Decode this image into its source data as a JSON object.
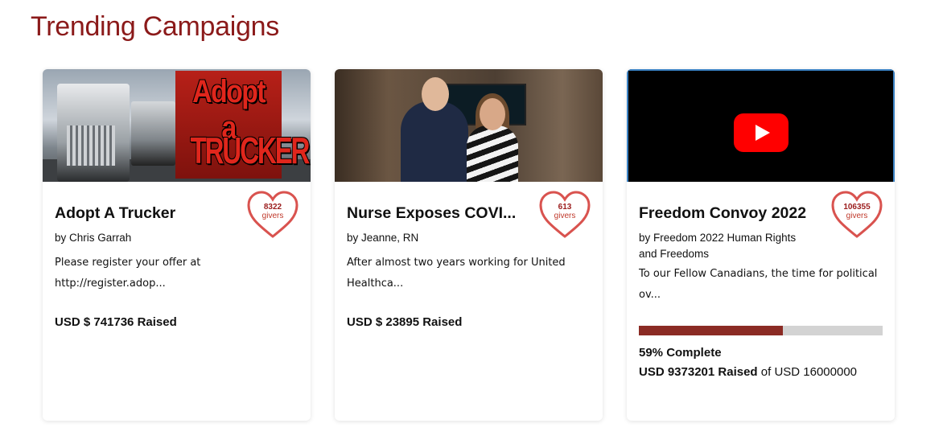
{
  "section": {
    "title": "Trending Campaigns"
  },
  "campaigns": [
    {
      "title": "Adopt A Trucker",
      "author": "by Chris Garrah",
      "description": "Please register your offer at http://register.adop...",
      "heart_count": "8322",
      "heart_label": "givers",
      "raised": "USD $ 741736 Raised",
      "thumbnail_text": [
        "Adopt a",
        "TRUCKER"
      ]
    },
    {
      "title": "Nurse Exposes COVI...",
      "author": "by Jeanne, RN",
      "description": "After almost two years working for United Healthca...",
      "heart_count": "613",
      "heart_label": "givers",
      "raised": "USD $ 23895 Raised"
    },
    {
      "title": "Freedom Convoy 2022",
      "author": "by Freedom 2022 Human Rights and Freedoms",
      "description": "To our Fellow Canadians, the time for political ov...",
      "heart_count": "106355",
      "heart_label": "givers",
      "progress_fraction": 0.59,
      "percent_label": "59% Complete",
      "raised_amount": "USD 9373201 Raised",
      "goal_text": "of USD 16000000"
    }
  ],
  "icons": {
    "heart": "heart-icon",
    "video": "youtube-play-icon"
  },
  "colors": {
    "title": "#8b1a1a",
    "heart": "#d9534f",
    "progress_fill": "#8b2b24",
    "progress_track": "#d3d3d3",
    "video_border": "#3b82c4"
  }
}
